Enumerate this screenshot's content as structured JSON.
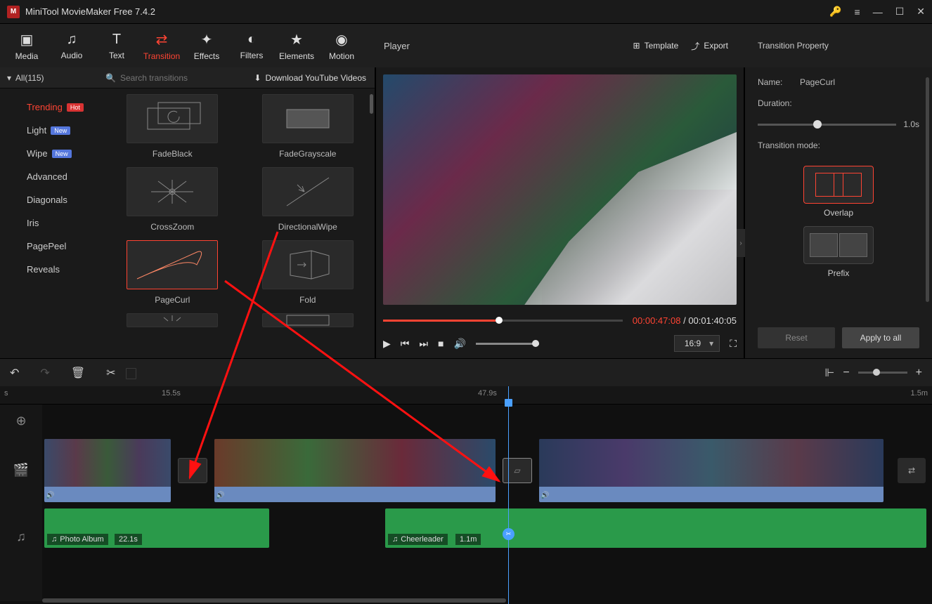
{
  "title": "MiniTool MovieMaker Free 7.4.2",
  "toolbar": {
    "tabs": [
      {
        "label": "Media",
        "icon": "📁"
      },
      {
        "label": "Audio",
        "icon": "♫"
      },
      {
        "label": "Text",
        "icon": "T"
      },
      {
        "label": "Transition",
        "icon": "⇄",
        "active": true
      },
      {
        "label": "Effects",
        "icon": "✦"
      },
      {
        "label": "Filters",
        "icon": "◐"
      },
      {
        "label": "Elements",
        "icon": "★"
      },
      {
        "label": "Motion",
        "icon": "◉"
      }
    ]
  },
  "categories": {
    "header": "All(115)",
    "search_placeholder": "Search transitions",
    "download_label": "Download YouTube Videos",
    "items": [
      {
        "label": "Trending",
        "badge": "Hot",
        "active": true
      },
      {
        "label": "Light",
        "badge": "New"
      },
      {
        "label": "Wipe",
        "badge": "New"
      },
      {
        "label": "Advanced"
      },
      {
        "label": "Diagonals"
      },
      {
        "label": "Iris"
      },
      {
        "label": "PagePeel"
      },
      {
        "label": "Reveals"
      }
    ]
  },
  "transitions": [
    {
      "label": "FadeBlack"
    },
    {
      "label": "FadeGrayscale"
    },
    {
      "label": "CrossZoom"
    },
    {
      "label": "DirectionalWipe"
    },
    {
      "label": "PageCurl",
      "selected": true
    },
    {
      "label": "Fold"
    }
  ],
  "player": {
    "title": "Player",
    "template_label": "Template",
    "export_label": "Export",
    "current_time": "00:00:47:08",
    "total_time": "00:01:40:05",
    "aspect": "16:9"
  },
  "property": {
    "title": "Transition Property",
    "name_label": "Name:",
    "name_value": "PageCurl",
    "duration_label": "Duration:",
    "duration_value": "1.0s",
    "mode_label": "Transition mode:",
    "modes": [
      {
        "label": "Overlap",
        "selected": true
      },
      {
        "label": "Prefix"
      }
    ],
    "reset_label": "Reset",
    "apply_label": "Apply to all"
  },
  "timeline": {
    "ruler": [
      "s",
      "15.5s",
      "47.9s",
      "1.5m"
    ],
    "audio_clips": [
      {
        "name": "Photo Album",
        "duration": "22.1s"
      },
      {
        "name": "Cheerleader",
        "duration": "1.1m"
      }
    ]
  }
}
